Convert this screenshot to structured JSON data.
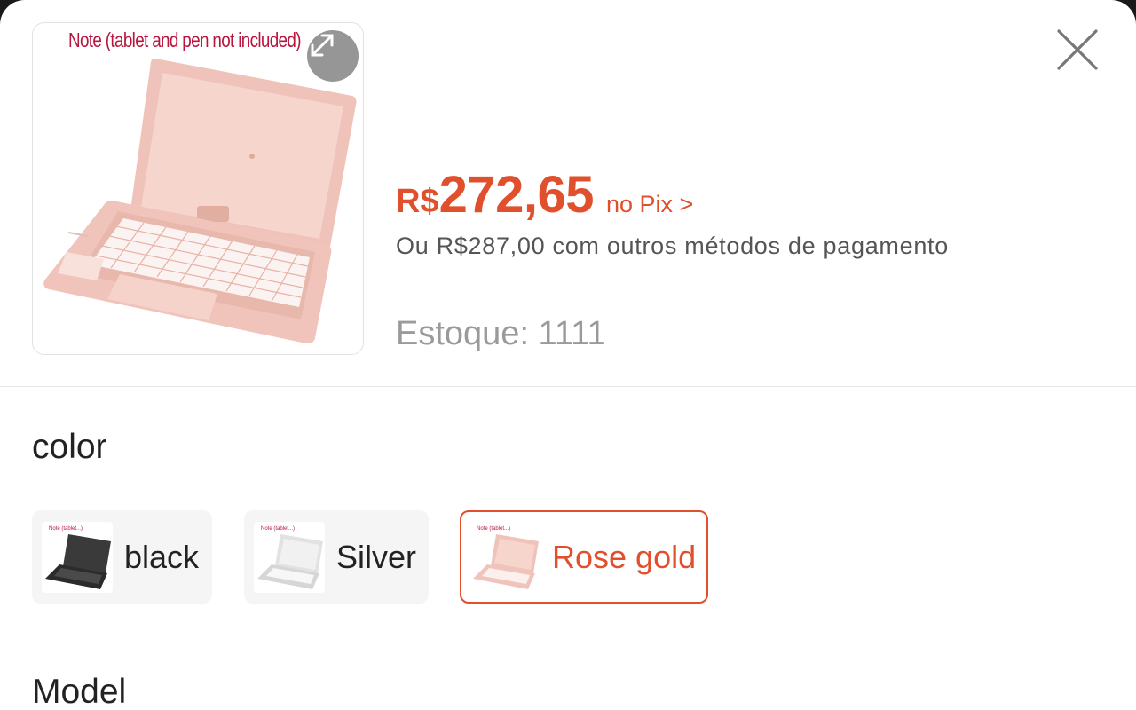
{
  "product": {
    "image_note": "Note (tablet and pen not included)",
    "expand_icon": "expand-diagonal-arrows"
  },
  "close_icon": "x-close",
  "price": {
    "currency": "R$",
    "amount": "272,65",
    "pix_label": "no Pix >",
    "alt_text": "Ou R$287,00 com outros métodos de pagamento"
  },
  "stock": {
    "text": "Estoque: 1111"
  },
  "color_section": {
    "title": "color",
    "options": [
      {
        "label": "black",
        "selected": false,
        "swatch": "#2b2b2b"
      },
      {
        "label": "Silver",
        "selected": false,
        "swatch": "#dcdcdc"
      },
      {
        "label": "Rose gold",
        "selected": true,
        "swatch": "#efc2b8"
      }
    ]
  },
  "model_section": {
    "title": "Model"
  },
  "colors": {
    "accent": "#e0502c",
    "rose_gold": "#f1c8bf",
    "divider": "#e6e6e6"
  }
}
